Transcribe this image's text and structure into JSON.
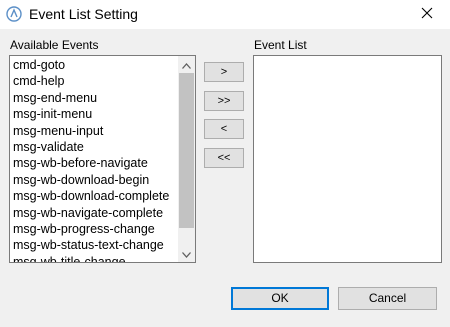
{
  "window": {
    "title": "Event List Setting",
    "app_icon": "app-logo-icon",
    "close_icon": "close-icon"
  },
  "available": {
    "label": "Available Events",
    "items": [
      "cmd-goto",
      "cmd-help",
      "msg-end-menu",
      "msg-init-menu",
      "msg-menu-input",
      "msg-validate",
      "msg-wb-before-navigate",
      "msg-wb-download-begin",
      "msg-wb-download-complete",
      "msg-wb-navigate-complete",
      "msg-wb-progress-change",
      "msg-wb-status-text-change",
      "msg-wb-title-change"
    ]
  },
  "event_list": {
    "label": "Event List",
    "items": []
  },
  "movers": {
    "add": ">",
    "add_all": ">>",
    "remove": "<",
    "remove_all": "<<"
  },
  "buttons": {
    "ok": "OK",
    "cancel": "Cancel"
  },
  "colors": {
    "accent": "#0078d7",
    "dialog_bg": "#f0f0f0"
  }
}
